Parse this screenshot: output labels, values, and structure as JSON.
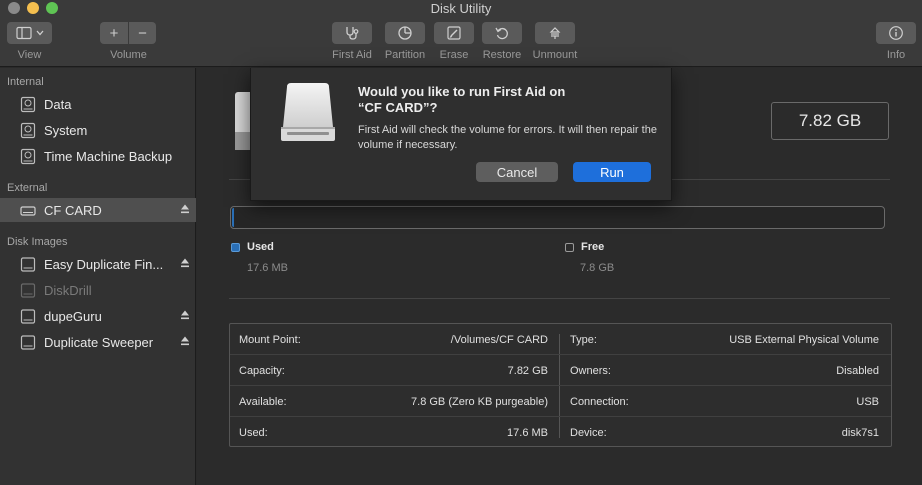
{
  "window": {
    "title": "Disk Utility"
  },
  "toolbar": {
    "view_label": "View",
    "volume_label": "Volume",
    "first_aid_label": "First Aid",
    "partition_label": "Partition",
    "erase_label": "Erase",
    "restore_label": "Restore",
    "unmount_label": "Unmount",
    "info_label": "Info",
    "volume_add_glyph": "+",
    "volume_remove_glyph": "−"
  },
  "sidebar": {
    "sections": [
      {
        "title": "Internal",
        "items": [
          {
            "label": "Data",
            "icon": "internal-disk-icon"
          },
          {
            "label": "System",
            "icon": "internal-disk-icon"
          },
          {
            "label": "Time Machine Backup",
            "icon": "internal-disk-icon"
          }
        ]
      },
      {
        "title": "External",
        "items": [
          {
            "label": "CF CARD",
            "icon": "external-disk-icon",
            "selected": true,
            "eject": true
          }
        ]
      },
      {
        "title": "Disk Images",
        "items": [
          {
            "label": "Easy Duplicate Fin...",
            "icon": "disk-image-icon",
            "eject": true
          },
          {
            "label": "DiskDrill",
            "icon": "disk-image-icon",
            "dimmed": true
          },
          {
            "label": "dupeGuru",
            "icon": "disk-image-icon",
            "eject": true
          },
          {
            "label": "Duplicate Sweeper",
            "icon": "disk-image-icon",
            "eject": true
          }
        ]
      }
    ]
  },
  "main": {
    "capacity": "7.82 GB",
    "usage": {
      "used_fraction": 0.002,
      "used_name": "Used",
      "used_value": "17.6 MB",
      "free_name": "Free",
      "free_value": "7.8 GB",
      "used_color": "#2a6fb6"
    },
    "info": {
      "left": [
        {
          "key": "Mount Point:",
          "value": "/Volumes/CF CARD"
        },
        {
          "key": "Capacity:",
          "value": "7.82 GB"
        },
        {
          "key": "Available:",
          "value": "7.8 GB (Zero KB purgeable)"
        },
        {
          "key": "Used:",
          "value": "17.6 MB"
        }
      ],
      "right": [
        {
          "key": "Type:",
          "value": "USB External Physical Volume"
        },
        {
          "key": "Owners:",
          "value": "Disabled"
        },
        {
          "key": "Connection:",
          "value": "USB"
        },
        {
          "key": "Device:",
          "value": "disk7s1"
        }
      ]
    }
  },
  "dialog": {
    "title_line1": "Would you like to run First Aid on",
    "title_line2": "“CF CARD”?",
    "message": "First Aid will check the volume for errors. It will then repair the volume if necessary.",
    "cancel_label": "Cancel",
    "run_label": "Run",
    "accent": "#1e6fdb"
  }
}
